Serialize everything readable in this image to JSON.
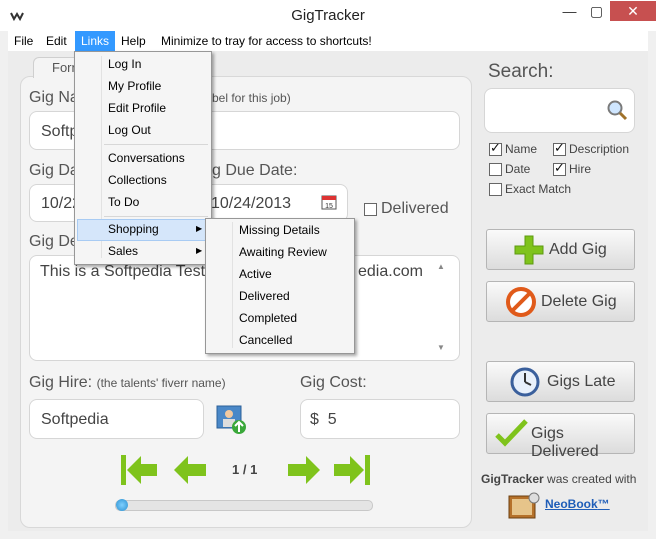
{
  "window": {
    "title": "GigTracker"
  },
  "menubar": {
    "file": "File",
    "edit": "Edit",
    "links": "Links",
    "help": "Help",
    "hint": "Minimize to tray for access to shortcuts!"
  },
  "links_menu": {
    "items": [
      "Log In",
      "My Profile",
      "Edit Profile",
      "Log Out",
      "Conversations",
      "Collections",
      "To Do",
      "Shopping",
      "Sales"
    ]
  },
  "shopping_menu": {
    "items": [
      "Missing Details",
      "Awaiting Review",
      "Active",
      "Delivered",
      "Completed",
      "Cancelled"
    ]
  },
  "form": {
    "tab": "Form",
    "gig_name_label": "Gig Na",
    "gig_name_hint": "bel for this job)",
    "gig_name_value": "Softpe",
    "gig_date_label": "Gig Da",
    "gig_date_value": "10/22",
    "due_date_label": "g Due Date:",
    "due_date_value": "10/24/2013",
    "delivered_label": "Delivered",
    "desc_label": "Gig De",
    "desc_value_left": "This is a Softpedia Test",
    "desc_value_right": "edia.com",
    "hire_label": "Gig Hire:",
    "hire_hint": "(the talents' fiverr name)",
    "hire_value": "Softpedia",
    "cost_label": "Gig Cost:",
    "cost_currency": "$",
    "cost_value": "5",
    "pager": "1 / 1"
  },
  "search": {
    "label": "Search:",
    "options": [
      {
        "label": "Name",
        "checked": true
      },
      {
        "label": "Description",
        "checked": true
      },
      {
        "label": "Date",
        "checked": false
      },
      {
        "label": "Hire",
        "checked": true
      },
      {
        "label": "Exact Match",
        "checked": false
      }
    ]
  },
  "buttons": {
    "add": "Add Gig",
    "delete": "Delete Gig",
    "late": "Gigs Late",
    "delivered": "Gigs Delivered"
  },
  "footer": {
    "created_bold": "GigTracker",
    "created_rest": " was created with",
    "neobook": "NeoBook",
    "tm": "™"
  },
  "colors": {
    "menu_highlight": "#3399ff",
    "green_arrow": "#7fc31c",
    "delete_red": "#e05a1a"
  }
}
